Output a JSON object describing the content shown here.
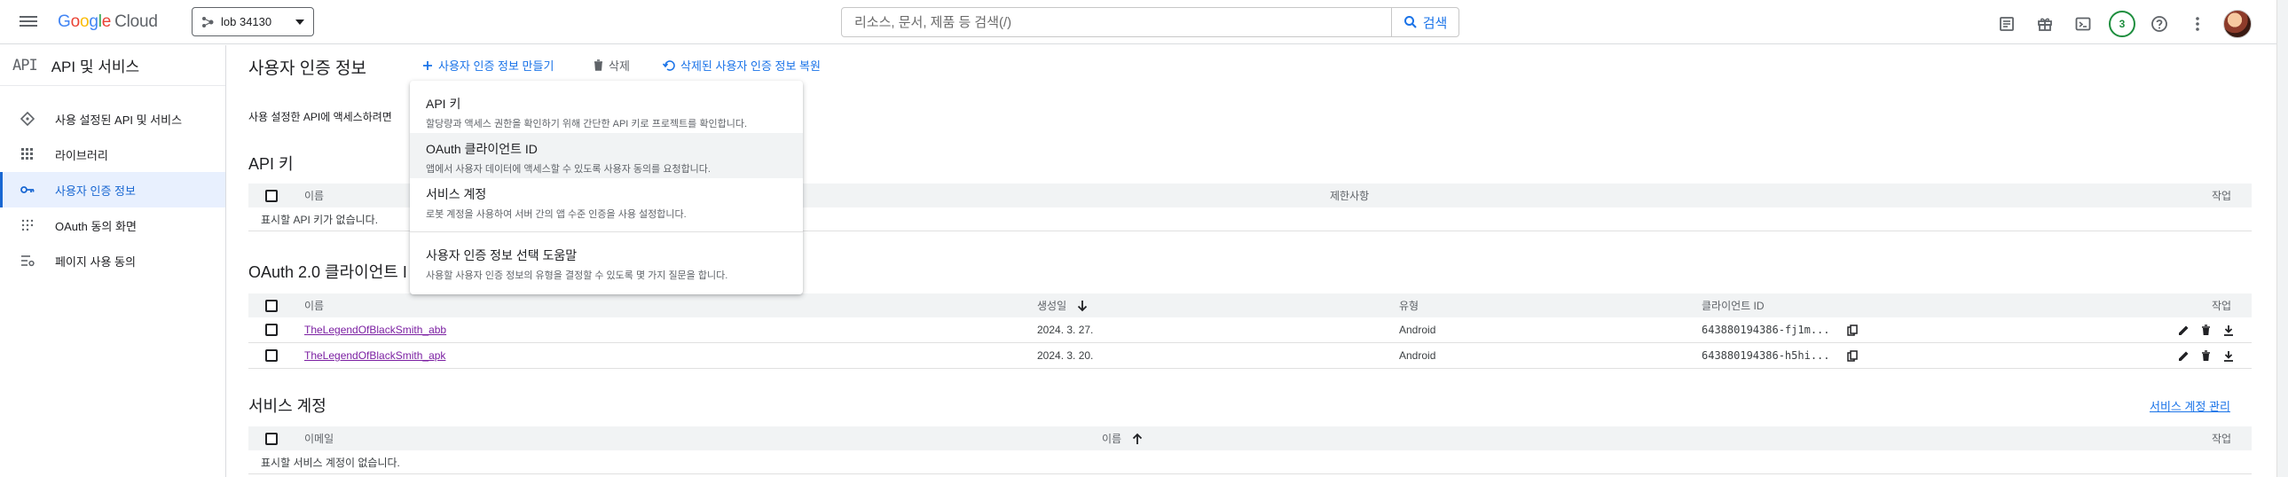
{
  "topbar": {
    "logo_letters": [
      "G",
      "o",
      "o",
      "g",
      "l",
      "e"
    ],
    "logo_product": "Cloud",
    "project": "lob 34130",
    "search_placeholder": "리소스, 문서, 제품 등 검색(/)",
    "search_button": "검색",
    "notification_count": "3"
  },
  "leftnav": {
    "header_logo": "API",
    "header_title": "API 및 서비스",
    "items": [
      {
        "label": "사용 설정된 API 및 서비스",
        "icon": "diamond-icon",
        "active": false
      },
      {
        "label": "라이브러리",
        "icon": "library-icon",
        "active": false
      },
      {
        "label": "사용자 인증 정보",
        "icon": "key-icon",
        "active": true
      },
      {
        "label": "OAuth 동의 화면",
        "icon": "consent-icon",
        "active": false
      },
      {
        "label": "페이지 사용 동의",
        "icon": "settings-list-icon",
        "active": false
      }
    ]
  },
  "main": {
    "title": "사용자 인증 정보",
    "actions": {
      "create": "사용자 인증 정보 만들기",
      "delete": "삭제",
      "restore": "삭제된 사용자 인증 정보 복원"
    },
    "intro": "사용 설정한 API에 액세스하려면"
  },
  "dropdown": {
    "items": [
      {
        "title": "API 키",
        "desc": "할당량과 액세스 권한을 확인하기 위해 간단한 API 키로 프로젝트를 확인합니다."
      },
      {
        "title": "OAuth 클라이언트 ID",
        "desc": "앱에서 사용자 데이터에 액세스할 수 있도록 사용자 동의를 요청합니다."
      },
      {
        "title": "서비스 계정",
        "desc": "로봇 계정을 사용하여 서버 간의 앱 수준 인증을 사용 설정합니다."
      }
    ],
    "help": {
      "title": "사용자 인증 정보 선택 도움말",
      "desc": "사용할 사용자 인증 정보의 유형을 결정할 수 있도록 몇 가지 질문을 합니다."
    }
  },
  "api_keys": {
    "title": "API 키",
    "headers": {
      "name": "이름",
      "restrictions": "제한사항",
      "actions": "작업"
    },
    "empty": "표시할 API 키가 없습니다."
  },
  "oauth": {
    "title": "OAuth 2.0 클라이언트 I",
    "headers": {
      "name": "이름",
      "created": "생성일",
      "type": "유형",
      "client_id": "클라이언트 ID",
      "actions": "작업"
    },
    "rows": [
      {
        "name": "TheLegendOfBlackSmith_abb",
        "created": "2024. 3. 27.",
        "type": "Android",
        "client_id": "643880194386-fj1m..."
      },
      {
        "name": "TheLegendOfBlackSmith_apk",
        "created": "2024. 3. 20.",
        "type": "Android",
        "client_id": "643880194386-h5hi..."
      }
    ]
  },
  "service_accounts": {
    "title": "서비스 계정",
    "manage_link": "서비스 계정 관리",
    "headers": {
      "email": "이메일",
      "name": "이름",
      "actions": "작업"
    },
    "empty": "표시할 서비스 계정이 없습니다."
  },
  "colors": {
    "accent": "#1a73e8",
    "visited_link": "#7b1fa2",
    "active_nav_bg": "#e8f0fe"
  }
}
